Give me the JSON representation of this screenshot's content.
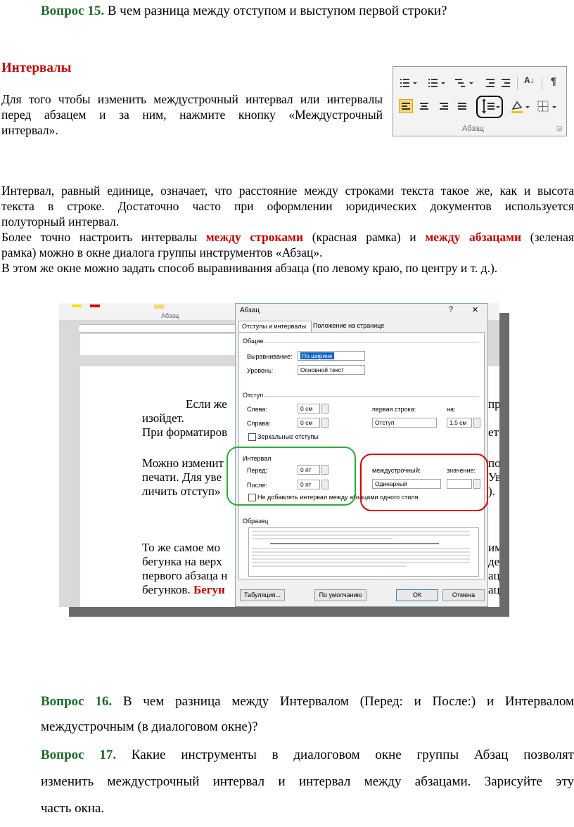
{
  "q15": {
    "label": "Вопрос 15.",
    "text": " В чем разница между отступом и выступом первой строки?"
  },
  "section_title": "Интервалы",
  "intro": {
    "line1": "Для того чтобы изменить междустрочный интервал или интервалы",
    "line2": "перед абзацем и за ним, нажмите кнопку «Междустрочный",
    "line3": "интервал»."
  },
  "ribbon": {
    "group_label": "Абзац",
    "sort_label": "A↓",
    "pilcrow": "¶"
  },
  "body": {
    "p1_l1": "Интервал, равный единице, означает, что расстояние между строками текста такое же, как и высота",
    "p1_l2": "текста в строке. Достаточно часто при оформлении юридических документов используется",
    "p1_l3": "полуторный интервал.",
    "p2_a": "Более точно настроить интервалы ",
    "p2_red1": "между строками",
    "p2_b": " (красная рамка) и ",
    "p2_red2": "между абзацами",
    "p2_c": " (зеленая",
    "p2_l2": "рамка) можно в окне диалога группы инструментов «Абзац».",
    "p3": "В этом же окне можно задать способ выравнивания абзаца (по левому краю, по центру и т. д.)."
  },
  "screenshot": {
    "ribbon_label": "Абзац",
    "doc_lines": {
      "l1": "Если же",
      "l1_right": "пр",
      "l2": "изойдет.",
      "l3": "При форматиров",
      "l3_right": "ет",
      "l4": "Можно изменит",
      "l4_right": "по",
      "l5": "печати. Для уве",
      "l5_right": "Ув",
      "l6": "личить отступ»",
      "l6_right": ").",
      "l7": "То же самое мо",
      "l7_right": "им",
      "l8": "бегунка на верх",
      "l8_right": "де",
      "l9": "первого абзаца н",
      "l9_right": "ац",
      "l10a": "бегунков. ",
      "l10b": "Бегун",
      "l10_right": "ац"
    },
    "dialog": {
      "title": "Абзац",
      "help": "?",
      "close": "✕",
      "tab1": "Отступы и интервалы",
      "tab2": "Положение на странице",
      "general": "Общие",
      "align_label": "Выравнивание:",
      "align_value": "По ширине",
      "level_label": "Уровень:",
      "level_value": "Основной текст",
      "indent": "Отступ",
      "left_label": "Слева:",
      "left_value": "0 см",
      "right_label": "Справа:",
      "right_value": "0 см",
      "first_label": "первая строка:",
      "first_value": "Отступ",
      "by_label": "на:",
      "by_value": "1,5 см",
      "mirror": "Зеркальные отступы",
      "interval": "Интервал",
      "before_label": "Перед:",
      "before_value": "0 пт",
      "after_label": "После:",
      "after_value": "0 пт",
      "line_label": "междустрочный:",
      "line_value": "Одинарный",
      "val_label": "значение:",
      "no_add": "Не добавлять интервал между абзацами одного стиля",
      "sample": "Образец",
      "btn_tabs": "Табуляция...",
      "btn_default": "По умолчанию",
      "btn_ok": "ОК",
      "btn_cancel": "Отмена"
    }
  },
  "q16": {
    "label": "Вопрос 16.",
    "text_l1": "  В чем разница между Интервалом (Перед: и После:) и Интервалом",
    "text_l2": "междустрочным (в диалоговом окне)?"
  },
  "q17": {
    "label": "Вопрос 17.",
    "text_l1": " Какие инструменты в диалоговом окне группы Абзац позволят",
    "text_l2": "изменить междустрочный интервал и интервал между абзацами. Зарисуйте эту",
    "text_l3": "часть окна."
  },
  "colors": {
    "green": "#1e6b2b",
    "red": "#c00000",
    "frame_green": "#2eaa3c",
    "frame_red": "#dd0000"
  }
}
